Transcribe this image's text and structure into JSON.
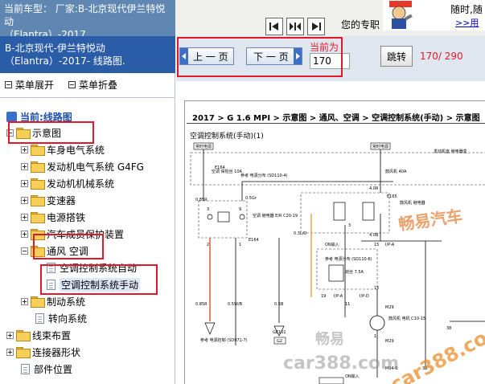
{
  "topbar": {
    "current_car_line1": "当前车型： 厂家:B-北京现代伊兰特悦动",
    "current_car_line2": "（Elantra）-2017",
    "ad_text": "您的专职",
    "ad_line1": "随时,随",
    "ad_line2": ">>用"
  },
  "left_panel": {
    "title_line1": "B-北京现代-伊兰特悦动",
    "title_line2": "（Elantra）-2017- 线路图.",
    "expand_label": "菜单展开",
    "collapse_label": "菜单折叠",
    "tree": {
      "current": "当前:线路图",
      "root": "示意图",
      "children": [
        "车身电气系统",
        "发动机电气系统 G4FG",
        "发动机机械系统",
        "变速器",
        "电源搭铁",
        "汽车成员保护装置",
        "通风 空调"
      ],
      "ventilation_children": [
        "空调控制系统自动",
        "空调控制系统手动"
      ],
      "after_children": [
        "制动系统",
        "转向系统"
      ],
      "top_level": [
        "线束布置",
        "连接器形状",
        "部件位置"
      ]
    }
  },
  "page_nav": {
    "prev_label": "上 一 页",
    "next_label": "下 一 页",
    "current_label": "当前为",
    "current_page": "170",
    "jump_label": "跳转",
    "page_count": "170/ 290"
  },
  "diagram": {
    "breadcrumb": "2017 > G 1.6 MPI > 示意图 > 通风、空调 > 空调控制系统(手动) > 示意图",
    "subtitle": "空调控制系统(手动)(1)",
    "labels": {
      "always_power_1": "常时电源",
      "always_power_2": "常时电源",
      "fuse_1": "空调\n保险丝\n10A",
      "fuse_2": "鼓风机\n40A",
      "e164": "E164",
      "e165": "E165",
      "e164b": "E164",
      "ref_1": "参考\n电源分布\n(SD110-4)",
      "ref_2": "参考\n电源分布\n(SD110-6)",
      "ref_3": "参考\n电源控制\n(SD971-7)",
      "relay": "空调\n继电器\nE/R\nC20-19",
      "blower_relay": "鼓风机\n继电器",
      "engine_box": "发动机室\n继电器盒",
      "wire_085r": "0.85R",
      "wire_05gr": "0.5Gr",
      "wire_03lo": "0.3L/O",
      "wire_40r": "4.0R",
      "wire_40b": "4.0B",
      "wire_05w": "0.5W/B",
      "wire_05b": "0.5B",
      "ge101": "GE101",
      "g2": "G2",
      "on_input": "ON输入",
      "on_input2": "ON输入",
      "ipa": "I/P-A",
      "ipd": "I/P-D",
      "ipa2": "I/P-A",
      "m29": "M29",
      "m29b": "M29",
      "m04b": "M04-B",
      "motor": "鼓风机\n电机\nC10-15",
      "fuse_3": "熔丝\n7.5A",
      "num_1": "3",
      "num_2": "9",
      "num_3": "19",
      "num_4": "15",
      "num_5": "2",
      "num_6": "1",
      "num_7": "3",
      "num_8": "11",
      "num_9": "15",
      "num_10": "1",
      "num_11": "30",
      "num_12": "38"
    },
    "watermarks": {
      "wm1": "畅易汽车",
      "wm2": "畅易",
      "wm3": "car388.com",
      "wm4": "car388.com"
    }
  },
  "colors": {
    "title_bar_blue": "#2a5ca8",
    "car_label_blue": "#5f87b2",
    "annotation_red": "#e0192a",
    "wire_red": "#e03a2a",
    "wire_orange": "#e39a2a"
  }
}
